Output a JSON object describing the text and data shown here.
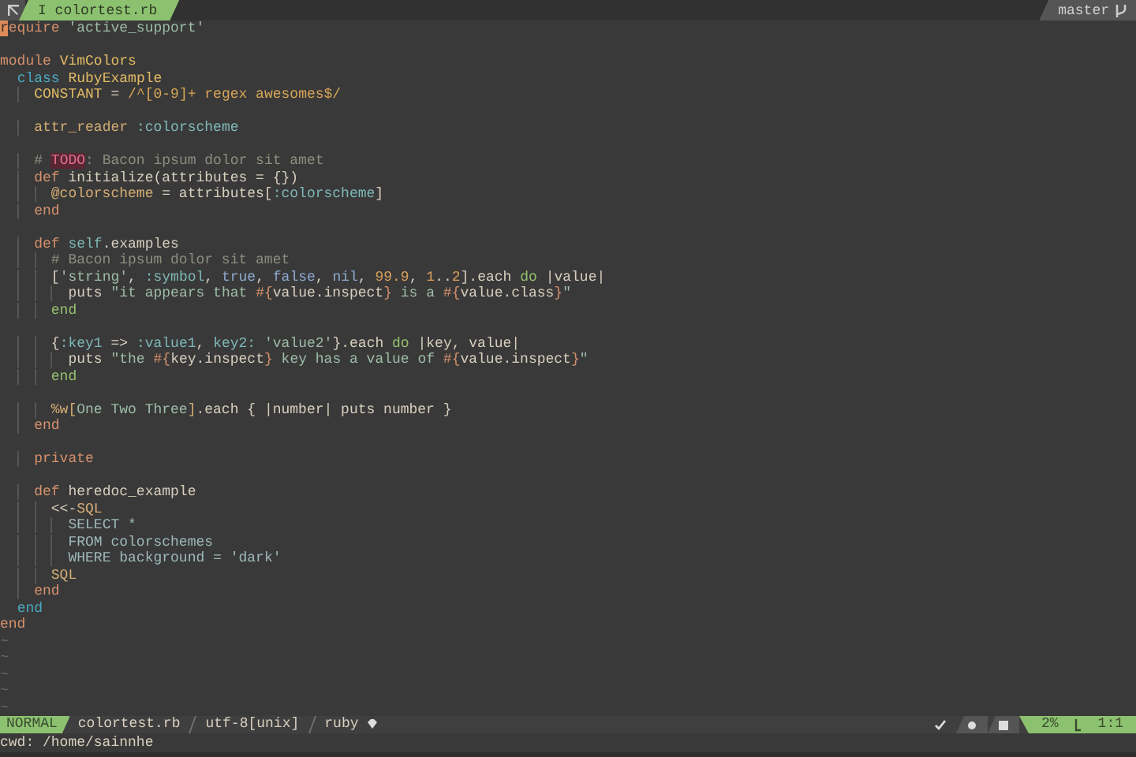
{
  "tabline": {
    "tab": {
      "label": "I colortest.rb",
      "selected": true
    },
    "branch": "master"
  },
  "lines": [
    {
      "kind": "code",
      "tokens": [
        {
          "kind": "cursor",
          "text": "r"
        },
        {
          "kind": "keyword",
          "text": "equire"
        },
        {
          "kind": "string",
          "text": " 'active_support'"
        }
      ]
    },
    {
      "kind": "blank"
    },
    {
      "kind": "code",
      "tokens": [
        {
          "kind": "keyword",
          "text": "module"
        },
        {
          "kind": "const",
          "text": " VimColors"
        }
      ]
    },
    {
      "kind": "code",
      "tokens": [
        {
          "kind": "keyword2",
          "text": "  class"
        },
        {
          "kind": "const",
          "text": " RubyExample"
        }
      ]
    },
    {
      "kind": "code",
      "tokens": [
        {
          "kind": "const",
          "text": "    CONSTANT"
        },
        {
          "kind": "plain",
          "text": " ="
        },
        {
          "kind": "regex",
          "text": " /^[0-9]+ regex awesomes$/"
        }
      ]
    },
    {
      "kind": "blank"
    },
    {
      "kind": "code",
      "tokens": [
        {
          "kind": "attr",
          "text": "    attr_reader"
        },
        {
          "kind": "symbol",
          "text": " :colorscheme"
        }
      ]
    },
    {
      "kind": "blank"
    },
    {
      "kind": "code",
      "tokens": [
        {
          "kind": "comment",
          "text": "    #"
        },
        {
          "kind": "todo",
          "text": " TODO"
        },
        {
          "kind": "comment",
          "text": ": Bacon ipsum dolor sit amet"
        }
      ]
    },
    {
      "kind": "code",
      "tokens": [
        {
          "kind": "keyword",
          "text": "    def"
        },
        {
          "kind": "plain",
          "text": " initialize(attributes = {})"
        }
      ]
    },
    {
      "kind": "code",
      "tokens": [
        {
          "kind": "ivar",
          "text": "      @colorscheme"
        },
        {
          "kind": "plain",
          "text": " = attributes["
        },
        {
          "kind": "symbol",
          "text": ":colorscheme"
        },
        {
          "kind": "plain",
          "text": "]"
        }
      ]
    },
    {
      "kind": "code",
      "tokens": [
        {
          "kind": "keyword",
          "text": "    end"
        }
      ]
    },
    {
      "kind": "blank"
    },
    {
      "kind": "code",
      "tokens": [
        {
          "kind": "keyword",
          "text": "    def"
        },
        {
          "kind": "method",
          "text": " self"
        },
        {
          "kind": "plain",
          "text": ".examples"
        }
      ]
    },
    {
      "kind": "code",
      "tokens": [
        {
          "kind": "comment",
          "text": "      # Bacon ipsum dolor sit amet"
        }
      ]
    },
    {
      "kind": "code",
      "tokens": [
        {
          "kind": "plain",
          "text": "      ["
        },
        {
          "kind": "string",
          "text": "'string'"
        },
        {
          "kind": "plain",
          "text": ","
        },
        {
          "kind": "symbol",
          "text": " :symbol"
        },
        {
          "kind": "plain",
          "text": ","
        },
        {
          "kind": "bool",
          "text": " true"
        },
        {
          "kind": "plain",
          "text": ","
        },
        {
          "kind": "bool",
          "text": " false"
        },
        {
          "kind": "plain",
          "text": ","
        },
        {
          "kind": "bool",
          "text": " nil"
        },
        {
          "kind": "plain",
          "text": ","
        },
        {
          "kind": "number",
          "text": " 99.9"
        },
        {
          "kind": "plain",
          "text": ","
        },
        {
          "kind": "number",
          "text": " 1"
        },
        {
          "kind": "plain",
          "text": ".."
        },
        {
          "kind": "number",
          "text": "2"
        },
        {
          "kind": "plain",
          "text": "].each"
        },
        {
          "kind": "block",
          "text": " do"
        },
        {
          "kind": "plain",
          "text": " |value|"
        }
      ]
    },
    {
      "kind": "code",
      "tokens": [
        {
          "kind": "plain",
          "text": "        puts"
        },
        {
          "kind": "string",
          "text": " \"it appears that "
        },
        {
          "kind": "interp",
          "text": "#{"
        },
        {
          "kind": "plain",
          "text": "value.inspect"
        },
        {
          "kind": "interp",
          "text": "}"
        },
        {
          "kind": "string",
          "text": " is a "
        },
        {
          "kind": "interp",
          "text": "#{"
        },
        {
          "kind": "plain",
          "text": "value.class"
        },
        {
          "kind": "interp",
          "text": "}"
        },
        {
          "kind": "string",
          "text": "\""
        }
      ]
    },
    {
      "kind": "code",
      "tokens": [
        {
          "kind": "block",
          "text": "      end"
        }
      ]
    },
    {
      "kind": "blank"
    },
    {
      "kind": "code",
      "tokens": [
        {
          "kind": "plain",
          "text": "      {"
        },
        {
          "kind": "symbol",
          "text": ":key1"
        },
        {
          "kind": "plain",
          "text": " =>"
        },
        {
          "kind": "symbol",
          "text": " :value1"
        },
        {
          "kind": "plain",
          "text": ","
        },
        {
          "kind": "symbol",
          "text": " key2:"
        },
        {
          "kind": "string",
          "text": " 'value2'"
        },
        {
          "kind": "plain",
          "text": "}.each"
        },
        {
          "kind": "block",
          "text": " do"
        },
        {
          "kind": "plain",
          "text": " |key, value|"
        }
      ]
    },
    {
      "kind": "code",
      "tokens": [
        {
          "kind": "plain",
          "text": "        puts"
        },
        {
          "kind": "string",
          "text": " \"the "
        },
        {
          "kind": "interp",
          "text": "#{"
        },
        {
          "kind": "plain",
          "text": "key.inspect"
        },
        {
          "kind": "interp",
          "text": "}"
        },
        {
          "kind": "string",
          "text": " key has a value of "
        },
        {
          "kind": "interp",
          "text": "#{"
        },
        {
          "kind": "plain",
          "text": "value.inspect"
        },
        {
          "kind": "interp",
          "text": "}"
        },
        {
          "kind": "string",
          "text": "\""
        }
      ]
    },
    {
      "kind": "code",
      "tokens": [
        {
          "kind": "block",
          "text": "      end"
        }
      ]
    },
    {
      "kind": "blank"
    },
    {
      "kind": "code",
      "tokens": [
        {
          "kind": "attr",
          "text": "      %w["
        },
        {
          "kind": "string",
          "text": "One Two Three"
        },
        {
          "kind": "attr",
          "text": "]"
        },
        {
          "kind": "plain",
          "text": ".each { |number| puts number }"
        }
      ]
    },
    {
      "kind": "code",
      "tokens": [
        {
          "kind": "keyword",
          "text": "    end"
        }
      ]
    },
    {
      "kind": "blank"
    },
    {
      "kind": "code",
      "tokens": [
        {
          "kind": "keyword",
          "text": "    private"
        }
      ]
    },
    {
      "kind": "blank"
    },
    {
      "kind": "code",
      "tokens": [
        {
          "kind": "keyword",
          "text": "    def"
        },
        {
          "kind": "plain",
          "text": " heredoc_example"
        }
      ]
    },
    {
      "kind": "code",
      "tokens": [
        {
          "kind": "plain",
          "text": "      <<-"
        },
        {
          "kind": "attr",
          "text": "SQL"
        }
      ]
    },
    {
      "kind": "code",
      "tokens": [
        {
          "kind": "heredoc",
          "text": "        SELECT *"
        }
      ]
    },
    {
      "kind": "code",
      "tokens": [
        {
          "kind": "heredoc",
          "text": "        FROM colorschemes"
        }
      ]
    },
    {
      "kind": "code",
      "tokens": [
        {
          "kind": "heredoc",
          "text": "        WHERE background = 'dark'"
        }
      ]
    },
    {
      "kind": "code",
      "tokens": [
        {
          "kind": "attr",
          "text": "      SQL"
        }
      ]
    },
    {
      "kind": "code",
      "tokens": [
        {
          "kind": "keyword",
          "text": "    end"
        }
      ]
    },
    {
      "kind": "code",
      "tokens": [
        {
          "kind": "keyword2",
          "text": "  end"
        }
      ]
    },
    {
      "kind": "code",
      "tokens": [
        {
          "kind": "keyword",
          "text": "end"
        }
      ]
    }
  ],
  "tildes": [
    "~",
    "~",
    "~",
    "~",
    "~"
  ],
  "statusline": {
    "mode": "NORMAL",
    "file": "colortest.rb",
    "encoding": "utf-8[unix]",
    "filetype": "ruby",
    "percent": "2%",
    "position": "1:1"
  },
  "cmdline": "cwd: /home/sainnhe"
}
